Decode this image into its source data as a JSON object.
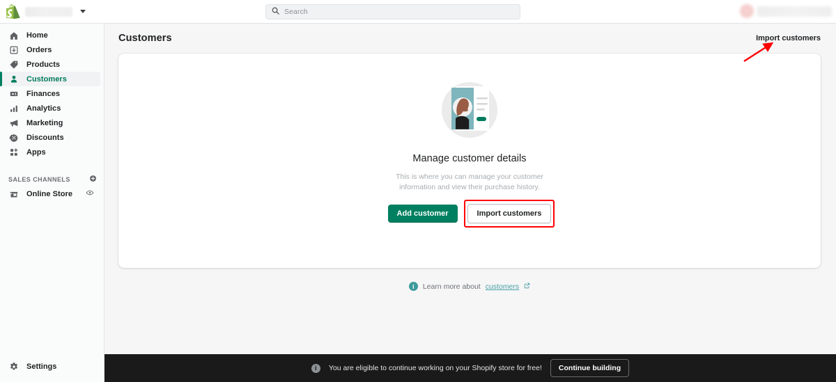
{
  "topbar": {
    "logo_icon": "shopify-bag-icon",
    "store_name_redacted": "",
    "store_switcher_icon": "chevron-down-icon",
    "search": {
      "placeholder": "Search",
      "value": "",
      "icon": "search-icon"
    },
    "user": {
      "avatar_icon": "avatar",
      "name_redacted": ""
    }
  },
  "sidebar": {
    "items": [
      {
        "label": "Home",
        "icon": "home-icon",
        "active": false
      },
      {
        "label": "Orders",
        "icon": "orders-icon",
        "active": false
      },
      {
        "label": "Products",
        "icon": "products-tag-icon",
        "active": false
      },
      {
        "label": "Customers",
        "icon": "customers-person-icon",
        "active": true
      },
      {
        "label": "Finances",
        "icon": "finances-banknote-icon",
        "active": false
      },
      {
        "label": "Analytics",
        "icon": "analytics-bar-chart-icon",
        "active": false
      },
      {
        "label": "Marketing",
        "icon": "marketing-megaphone-icon",
        "active": false
      },
      {
        "label": "Discounts",
        "icon": "discounts-icon",
        "active": false
      },
      {
        "label": "Apps",
        "icon": "apps-grid-icon",
        "active": false
      }
    ],
    "sales_channels": {
      "title": "SALES CHANNELS",
      "add_icon": "plus-circle-icon",
      "items": [
        {
          "label": "Online Store",
          "icon": "storefront-icon",
          "trailing_icon": "eye-icon"
        }
      ]
    },
    "settings": {
      "label": "Settings",
      "icon": "gear-icon"
    }
  },
  "main": {
    "page_title": "Customers",
    "header_action": {
      "label": "Import customers"
    },
    "empty_state": {
      "illustration": "customer-profile-card-illustration",
      "title": "Manage customer details",
      "body": "This is where you can manage your customer information and view their purchase history.",
      "primary_button": "Add customer",
      "secondary_button": "Import customers"
    },
    "learn_more": {
      "icon": "info-icon",
      "prefix": "Learn more about",
      "link_label": "customers",
      "external_icon": "external-link-icon"
    }
  },
  "banner": {
    "icon": "info-icon",
    "text": "You are eligible to continue working on your Shopify store for free!",
    "button": "Continue building"
  },
  "annotations": {
    "arrow_color": "#ff0000",
    "highlight_color": "#ff0000",
    "arrow_target": "Import customers"
  },
  "colors": {
    "brand_green": "#008060",
    "active_text": "#007b5c",
    "page_bg": "#f6f6f7",
    "sidebar_bg": "#fafbfb",
    "banner_bg": "#1a1a1a",
    "link_teal": "#4b9fa6"
  }
}
